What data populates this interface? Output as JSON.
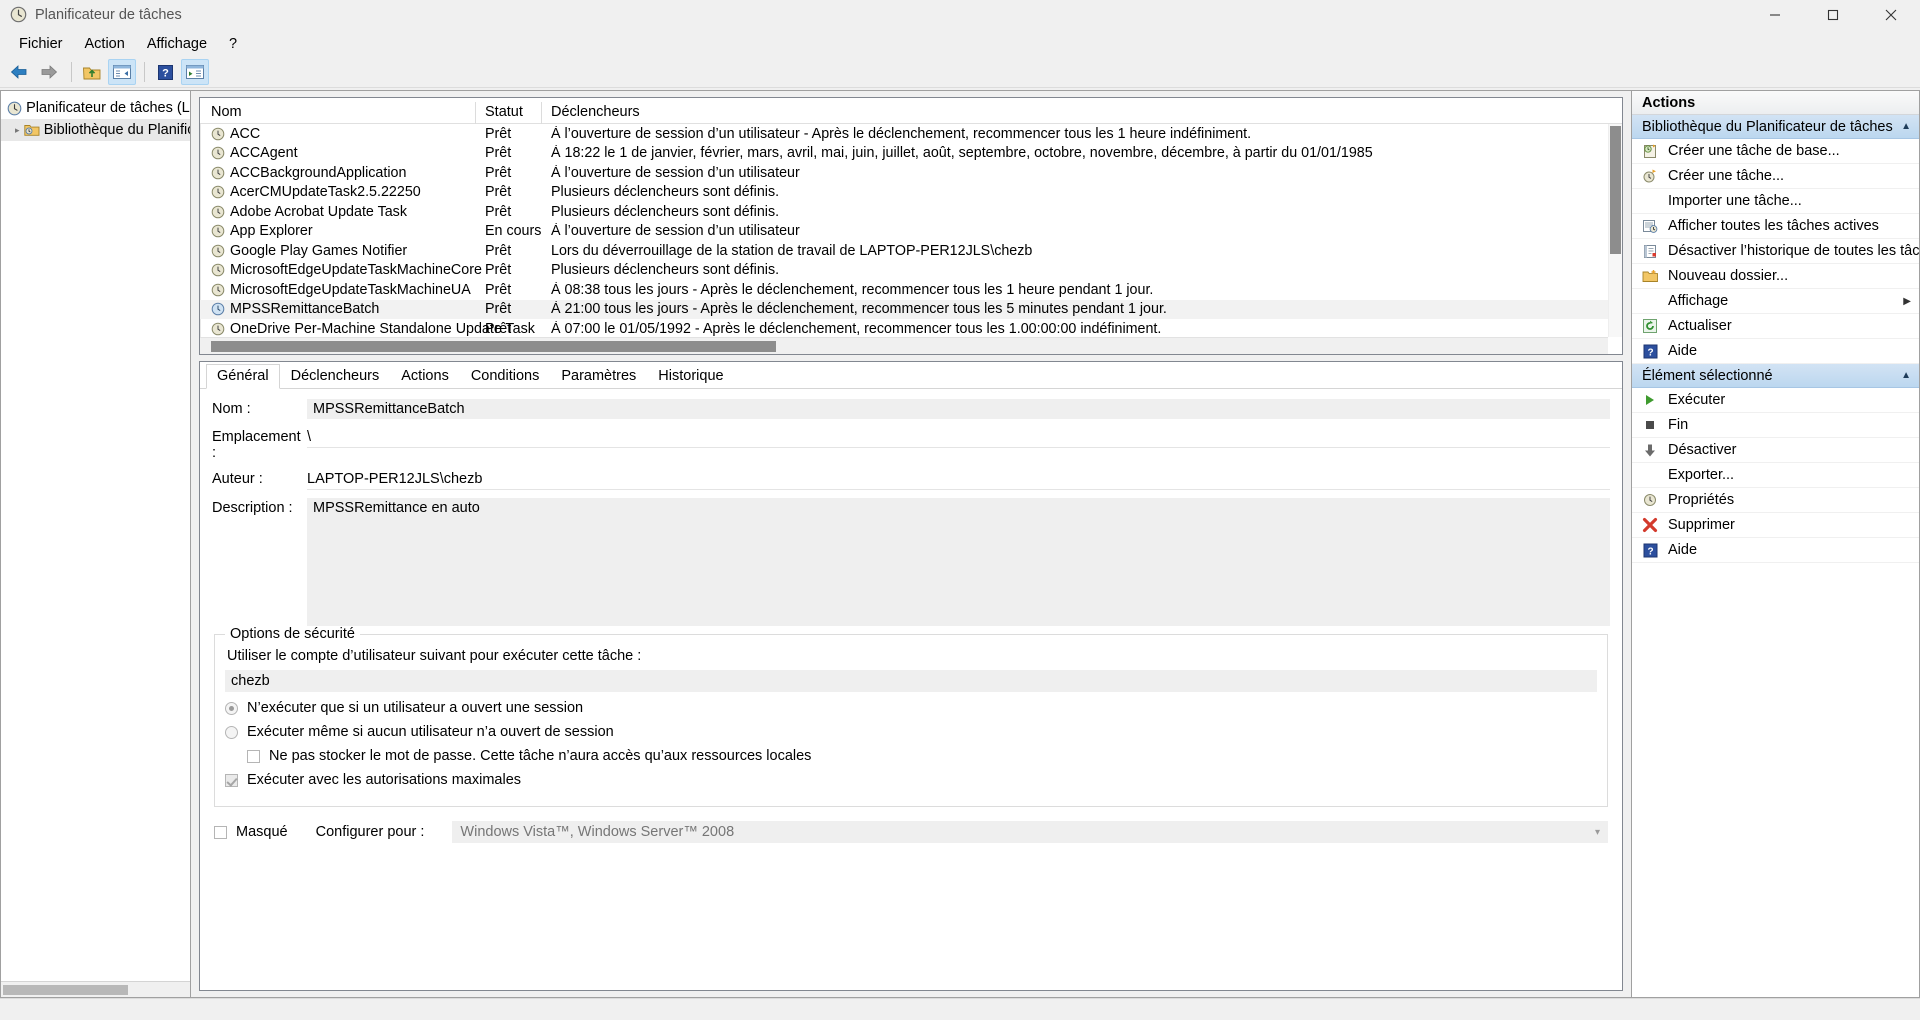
{
  "window": {
    "title": "Planificateur de tâches",
    "icon": "clock-icon",
    "minimize": "minimize-button",
    "maximize": "maximize-button",
    "close": "close-button"
  },
  "menubar": {
    "items": [
      {
        "label": "Fichier",
        "name": "menu-fichier"
      },
      {
        "label": "Action",
        "name": "menu-action"
      },
      {
        "label": "Affichage",
        "name": "menu-affichage"
      },
      {
        "label": "?",
        "name": "menu-aide"
      }
    ]
  },
  "toolbar": {
    "buttons": [
      {
        "name": "back-button",
        "icon": "arrow-left-icon",
        "selected": false
      },
      {
        "name": "forward-button",
        "icon": "arrow-right-icon",
        "selected": false
      },
      {
        "name": "up-folder-button",
        "icon": "folder-up-icon",
        "selected": false
      },
      {
        "name": "show-console-tree-button",
        "icon": "console-tree-icon",
        "selected": true
      },
      {
        "name": "help-button",
        "icon": "question-mark-icon",
        "selected": false
      },
      {
        "name": "show-action-pane-button",
        "icon": "action-pane-icon",
        "selected": true
      }
    ]
  },
  "tree": {
    "root": {
      "label": "Planificateur de tâches (Local)",
      "icon": "clock-icon"
    },
    "child": {
      "label": "Bibliothèque du Planificat",
      "icon": "folder-clock-icon",
      "selected": true,
      "expander": "chevron-right-icon"
    }
  },
  "list": {
    "columns": [
      "Nom",
      "Statut",
      "Déclencheurs"
    ],
    "rows": [
      {
        "name": "ACC",
        "status": "Prêt",
        "trigger": "À l’ouverture de session d’un utilisateur - Après le déclenchement, recommencer tous les 1 heure indéfiniment.",
        "selected": false
      },
      {
        "name": "ACCAgent",
        "status": "Prêt",
        "trigger": "À 18:22 le 1 de janvier, février, mars, avril, mai, juin, juillet, août, septembre, octobre, novembre, décembre, à partir du 01/01/1985",
        "selected": false
      },
      {
        "name": "ACCBackgroundApplication",
        "status": "Prêt",
        "trigger": "À l’ouverture de session d’un utilisateur",
        "selected": false
      },
      {
        "name": "AcerCMUpdateTask2.5.22250",
        "status": "Prêt",
        "trigger": "Plusieurs déclencheurs sont définis.",
        "selected": false
      },
      {
        "name": "Adobe Acrobat Update Task",
        "status": "Prêt",
        "trigger": "Plusieurs déclencheurs sont définis.",
        "selected": false
      },
      {
        "name": "App Explorer",
        "status": "En cours",
        "trigger": "À l’ouverture de session d’un utilisateur",
        "selected": false
      },
      {
        "name": "Google Play Games Notifier",
        "status": "Prêt",
        "trigger": "Lors du déverrouillage de la station de travail de LAPTOP-PER12JLS\\chezb",
        "selected": false
      },
      {
        "name": "MicrosoftEdgeUpdateTaskMachineCore",
        "status": "Prêt",
        "trigger": "Plusieurs déclencheurs sont définis.",
        "selected": false
      },
      {
        "name": "MicrosoftEdgeUpdateTaskMachineUA",
        "status": "Prêt",
        "trigger": "À 08:38 tous les jours - Après le déclenchement, recommencer tous les 1 heure pendant 1 jour.",
        "selected": false
      },
      {
        "name": "MPSSRemittanceBatch",
        "status": "Prêt",
        "trigger": "À 21:00 tous les jours - Après le déclenchement, recommencer tous les 5 minutes pendant 1 jour.",
        "selected": true
      },
      {
        "name": "OneDrive Per-Machine Standalone Update Task",
        "status": "Prêt",
        "trigger": "À 07:00 le 01/05/1992 - Après le déclenchement, recommencer tous les 1.00:00:00 indéfiniment.",
        "selected": false
      }
    ]
  },
  "details": {
    "tabs": [
      {
        "label": "Général",
        "active": true
      },
      {
        "label": "Déclencheurs",
        "active": false
      },
      {
        "label": "Actions",
        "active": false
      },
      {
        "label": "Conditions",
        "active": false
      },
      {
        "label": "Paramètres",
        "active": false
      },
      {
        "label": "Historique",
        "active": false
      }
    ],
    "fields": {
      "nom_label": "Nom :",
      "nom_value": "MPSSRemittanceBatch",
      "emplacement_label": "Emplacement :",
      "emplacement_value": "\\",
      "auteur_label": "Auteur :",
      "auteur_value": "LAPTOP-PER12JLS\\chezb",
      "description_label": "Description :",
      "description_value": "MPSSRemittance en auto"
    },
    "security": {
      "group_title": "Options de sécurité",
      "account_line": "Utiliser le compte d’utilisateur suivant pour exécuter cette tâche :",
      "account_value": "chezb",
      "radio_logged_on": "N’exécuter que si un utilisateur a ouvert une session",
      "radio_any": "Exécuter même si aucun utilisateur n’a ouvert de session",
      "checkbox_no_password": "Ne pas stocker le mot de passe. Cette tâche n’aura accès qu’aux ressources locales",
      "checkbox_highest": "Exécuter avec les autorisations maximales"
    },
    "bottom": {
      "hidden_label": "Masqué",
      "configure_label": "Configurer pour :",
      "configure_value": "Windows Vista™, Windows Server™ 2008"
    }
  },
  "actions": {
    "title": "Actions",
    "groups": [
      {
        "header": "Bibliothèque du Planificateur de tâches",
        "collapse_icon": "chevron-up-icon",
        "items": [
          {
            "label": "Créer une tâche de base...",
            "icon": "create-basic-task-icon",
            "has_icon": true,
            "submenu": false
          },
          {
            "label": "Créer une tâche...",
            "icon": "create-task-icon",
            "has_icon": true,
            "submenu": false
          },
          {
            "label": "Importer une tâche...",
            "icon": "",
            "has_icon": false,
            "submenu": false
          },
          {
            "label": "Afficher toutes les tâches actives",
            "icon": "running-tasks-icon",
            "has_icon": true,
            "submenu": false
          },
          {
            "label": "Désactiver l’historique de toutes les tâches",
            "icon": "history-icon",
            "has_icon": true,
            "submenu": false
          },
          {
            "label": "Nouveau dossier...",
            "icon": "new-folder-icon",
            "has_icon": true,
            "submenu": false
          },
          {
            "label": "Affichage",
            "icon": "",
            "has_icon": false,
            "submenu": true
          },
          {
            "label": "Actualiser",
            "icon": "refresh-icon",
            "has_icon": true,
            "submenu": false
          },
          {
            "label": "Aide",
            "icon": "help-icon",
            "has_icon": true,
            "submenu": false
          }
        ]
      },
      {
        "header": "Élément sélectionné",
        "collapse_icon": "chevron-up-icon",
        "items": [
          {
            "label": "Exécuter",
            "icon": "play-icon",
            "has_icon": true,
            "submenu": false
          },
          {
            "label": "Fin",
            "icon": "stop-icon",
            "has_icon": true,
            "submenu": false
          },
          {
            "label": "Désactiver",
            "icon": "down-arrow-icon",
            "has_icon": true,
            "submenu": false
          },
          {
            "label": "Exporter...",
            "icon": "",
            "has_icon": false,
            "submenu": false
          },
          {
            "label": "Propriétés",
            "icon": "properties-clock-icon",
            "has_icon": true,
            "submenu": false
          },
          {
            "label": "Supprimer",
            "icon": "delete-x-icon",
            "has_icon": true,
            "submenu": false
          },
          {
            "label": "Aide",
            "icon": "help-icon",
            "has_icon": true,
            "submenu": false
          }
        ]
      }
    ]
  },
  "colors": {
    "accent_header": "#bcd7ef",
    "selected_row": "#f2f2f2",
    "toolbar_selected": "#cce4f7",
    "field_bg": "#efefef",
    "delete_red": "#d33a2c",
    "run_green": "#3f9b2f"
  }
}
